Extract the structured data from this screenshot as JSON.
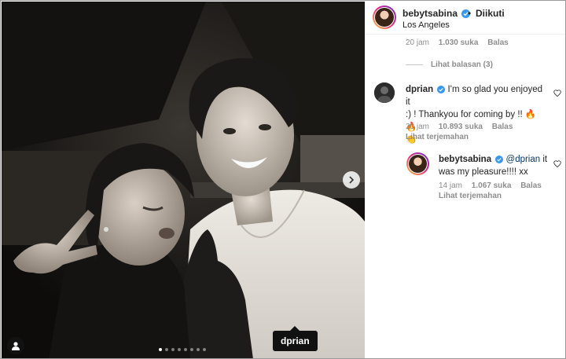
{
  "post": {
    "username": "bebytsabina",
    "separator": "•",
    "follow_status": "Diikuti",
    "location": "Los Angeles"
  },
  "photo": {
    "tag_username": "dprian",
    "carousel_total": 8,
    "carousel_active": 1
  },
  "comments": {
    "first": {
      "time": "20 jam",
      "likes": "1.030 suka",
      "reply": "Balas",
      "view_replies": "Lihat balasan (3)"
    },
    "second": {
      "username": "dprian",
      "text_line1": "I'm so glad you enjoyed it",
      "text_line2": ":) ! Thankyou for coming by !! 🔥🔥",
      "text_line3": "👏",
      "time": "20 jam",
      "likes": "10.893 suka",
      "reply": "Balas",
      "translate": "Lihat terjemahan"
    },
    "reply": {
      "username": "bebytsabina",
      "mention": "@dprian",
      "text_after_mention": " it",
      "text_line2": "was my pleasure!!!! xx",
      "time": "14 jam",
      "likes": "1.067 suka",
      "reply": "Balas",
      "translate": "Lihat terjemahan"
    }
  },
  "colors": {
    "verified_badge": "#3897f0",
    "secondary_text": "#8e8e8e",
    "mention": "#00376b"
  }
}
